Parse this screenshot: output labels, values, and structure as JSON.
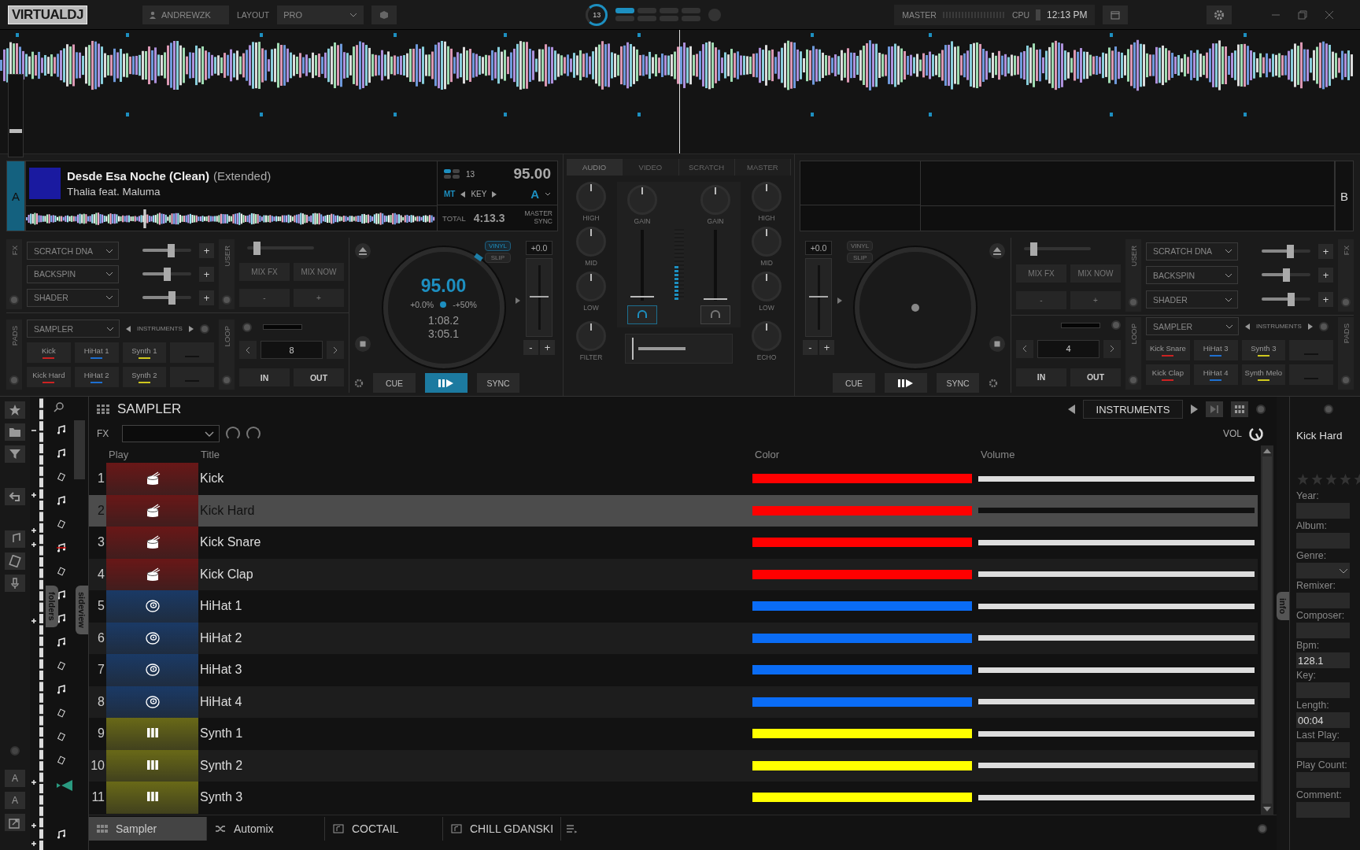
{
  "top_bar": {
    "logo": "VIRTUALDJ",
    "user": "ANDREWZK",
    "layout_label": "LAYOUT",
    "layout": "PRO",
    "beat_count": "13",
    "master_label": "MASTER",
    "cpu_label": "CPU",
    "clock": "12:13 PM"
  },
  "waveform_zoom": {
    "level": 0.3
  },
  "decks": [
    {
      "letter": "A",
      "title": "Desde Esa Noche (Clean)",
      "title_extra": "(Extended)",
      "artist": "Thalia feat. Maluma",
      "key_number": "13",
      "bpm": "95.00",
      "mt": "MT",
      "key_label": "KEY",
      "key": "A",
      "total_label": "TOTAL",
      "total": "4:13.3",
      "master_sync": "MASTER SYNC",
      "fx_label": "FX",
      "fx": [
        {
          "name": "SCRATCH DNA",
          "add": "+",
          "level": 0.6
        },
        {
          "name": "BACKSPIN",
          "add": "+",
          "level": 0.5
        },
        {
          "name": "SHADER",
          "add": "+",
          "level": 0.62
        }
      ],
      "user_label": "USER",
      "user_slider": {
        "level": 0.1
      },
      "mix_fx": "MIX FX",
      "mix_now": "MIX NOW",
      "minus": "-",
      "plus": "+",
      "pads_label": "PADS",
      "pad_mode": "SAMPLER",
      "pad_page": "INSTRUMENTS",
      "pads": [
        {
          "kind": "sample",
          "label": "Kick",
          "color": "#cc2222"
        },
        {
          "kind": "sample",
          "label": "HiHat 1",
          "color": "#1e6fd0"
        },
        {
          "kind": "sample",
          "label": "Synth 1",
          "color": "#d0c81e"
        },
        {
          "kind": "empty"
        },
        {
          "kind": "sample",
          "label": "Kick Hard",
          "color": "#cc2222"
        },
        {
          "kind": "sample",
          "label": "HiHat 2",
          "color": "#1e6fd0"
        },
        {
          "kind": "sample",
          "label": "Synth 2",
          "color": "#d0c81e"
        },
        {
          "kind": "empty"
        }
      ],
      "loop_label": "LOOP",
      "loop_size": "8",
      "loop_in": "IN",
      "loop_out": "OUT",
      "vinyl": {
        "label": "VINYL",
        "on": true
      },
      "slip": {
        "label": "SLIP",
        "on": false
      },
      "pitch": "+0.0",
      "pitch_minus": "-",
      "pitch_plus": "+",
      "jog": {
        "bpm": "95.00",
        "pitch": "+0.0%",
        "range": "-+50%",
        "elapsed": "1:08.2",
        "remaining": "3:05.1"
      },
      "cue": "CUE",
      "sync": "SYNC",
      "playing": true
    },
    {
      "letter": "B",
      "fx_label": "FX",
      "fx": [
        {
          "name": "SCRATCH DNA",
          "add": "+",
          "level": 0.6
        },
        {
          "name": "BACKSPIN",
          "add": "+",
          "level": 0.5
        },
        {
          "name": "SHADER",
          "add": "+",
          "level": 0.62
        }
      ],
      "user_label": "USER",
      "user_slider": {
        "level": 0.1
      },
      "mix_fx": "MIX FX",
      "mix_now": "MIX NOW",
      "minus": "-",
      "plus": "+",
      "pads_label": "PADS",
      "pad_mode": "SAMPLER",
      "pad_page": "INSTRUMENTS",
      "pads": [
        {
          "kind": "sample",
          "label": "Kick Snare",
          "color": "#cc2222"
        },
        {
          "kind": "sample",
          "label": "HiHat 3",
          "color": "#1e6fd0"
        },
        {
          "kind": "sample",
          "label": "Synth 3",
          "color": "#d0c81e"
        },
        {
          "kind": "empty"
        },
        {
          "kind": "sample",
          "label": "Kick Clap",
          "color": "#cc2222"
        },
        {
          "kind": "sample",
          "label": "HiHat 4",
          "color": "#1e6fd0"
        },
        {
          "kind": "sample",
          "label": "Synth Melo",
          "color": "#d0c81e"
        },
        {
          "kind": "empty"
        }
      ],
      "loop_label": "LOOP",
      "loop_size": "4",
      "loop_in": "IN",
      "loop_out": "OUT",
      "vinyl": {
        "label": "VINYL",
        "on": false
      },
      "slip": {
        "label": "SLIP",
        "on": false
      },
      "pitch": "+0.0",
      "pitch_minus": "-",
      "pitch_plus": "+",
      "cue": "CUE",
      "sync": "SYNC",
      "playing": false
    }
  ],
  "mixer": {
    "tabs": [
      {
        "label": "AUDIO",
        "selected": true
      },
      {
        "label": "VIDEO",
        "selected": false
      },
      {
        "label": "SCRATCH",
        "selected": false
      },
      {
        "label": "MASTER",
        "selected": false
      }
    ],
    "left_knobs": [
      "HIGH",
      "MID",
      "LOW",
      "FILTER"
    ],
    "right_knobs": [
      "HIGH",
      "MID",
      "LOW",
      "ECHO"
    ],
    "channels": [
      {
        "gain_label": "GAIN",
        "headphone_on": true,
        "level": 0.05
      },
      {
        "gain_label": "GAIN",
        "headphone_on": false,
        "level": 0.02
      }
    ],
    "vu": {
      "level": 0.5
    }
  },
  "sidebar": [
    {
      "kind": "star"
    },
    {
      "kind": "folder"
    },
    {
      "kind": "filter"
    },
    {
      "kind": "back"
    },
    {
      "kind": "note"
    },
    {
      "kind": "video"
    },
    {
      "kind": "mic"
    },
    {
      "kind": "font",
      "label": "A"
    },
    {
      "kind": "font",
      "label": "A"
    },
    {
      "kind": "window"
    }
  ],
  "side_tabs": [
    "folders",
    "sideview"
  ],
  "sampler": {
    "title": "SAMPLER",
    "fx_label": "FX",
    "page": "INSTRUMENTS",
    "vol_label": "VOL",
    "columns": [
      "Play",
      "Title",
      "Color",
      "Volume"
    ],
    "rows": [
      {
        "number": "1",
        "title": "Kick",
        "kind": "drum",
        "color": "#ff0000",
        "level": 1,
        "selected": false
      },
      {
        "number": "2",
        "title": "Kick Hard",
        "kind": "drum",
        "color": "#ff0000",
        "level": 1,
        "selected": true
      },
      {
        "number": "3",
        "title": "Kick Snare",
        "kind": "drum",
        "color": "#ff0000",
        "level": 1,
        "selected": false
      },
      {
        "number": "4",
        "title": "Kick Clap",
        "kind": "drum",
        "color": "#ff0000",
        "level": 1,
        "selected": false
      },
      {
        "number": "5",
        "title": "HiHat 1",
        "kind": "hihat",
        "color": "#0a6cf5",
        "level": 1,
        "selected": false
      },
      {
        "number": "6",
        "title": "HiHat 2",
        "kind": "hihat",
        "color": "#0a6cf5",
        "level": 1,
        "selected": false
      },
      {
        "number": "7",
        "title": "HiHat 3",
        "kind": "hihat",
        "color": "#0a6cf5",
        "level": 1,
        "selected": false
      },
      {
        "number": "8",
        "title": "HiHat 4",
        "kind": "hihat",
        "color": "#0a6cf5",
        "level": 1,
        "selected": false
      },
      {
        "number": "9",
        "title": "Synth 1",
        "kind": "synth",
        "color": "#ffff00",
        "level": 1,
        "selected": false
      },
      {
        "number": "10",
        "title": "Synth 2",
        "kind": "synth",
        "color": "#ffff00",
        "level": 1,
        "selected": false
      },
      {
        "number": "11",
        "title": "Synth 3",
        "kind": "synth",
        "color": "#ffff00",
        "level": 1,
        "selected": false
      }
    ],
    "tabs": [
      {
        "label": "Sampler",
        "kind": "sampler",
        "selected": true
      },
      {
        "label": "Automix",
        "kind": "automix",
        "selected": false
      },
      {
        "label": "COCTAIL",
        "kind": "playlist",
        "selected": false
      },
      {
        "label": "CHILL GDANSKI",
        "kind": "playlist",
        "selected": false
      }
    ]
  },
  "info": {
    "tab": "info",
    "title": "Kick Hard",
    "stars": 0,
    "fields": [
      {
        "label": "Year:"
      },
      {
        "label": "Album:"
      },
      {
        "label": "Genre:",
        "kind": "dropdown"
      },
      {
        "label": "Remixer:"
      },
      {
        "label": "Composer:"
      },
      {
        "label": "Bpm:",
        "value": "128.1"
      },
      {
        "label": "Key:"
      },
      {
        "label": "Length:",
        "value": "00:04"
      },
      {
        "label": "Last Play:"
      },
      {
        "label": "Play Count:"
      },
      {
        "label": "Comment:"
      }
    ]
  }
}
